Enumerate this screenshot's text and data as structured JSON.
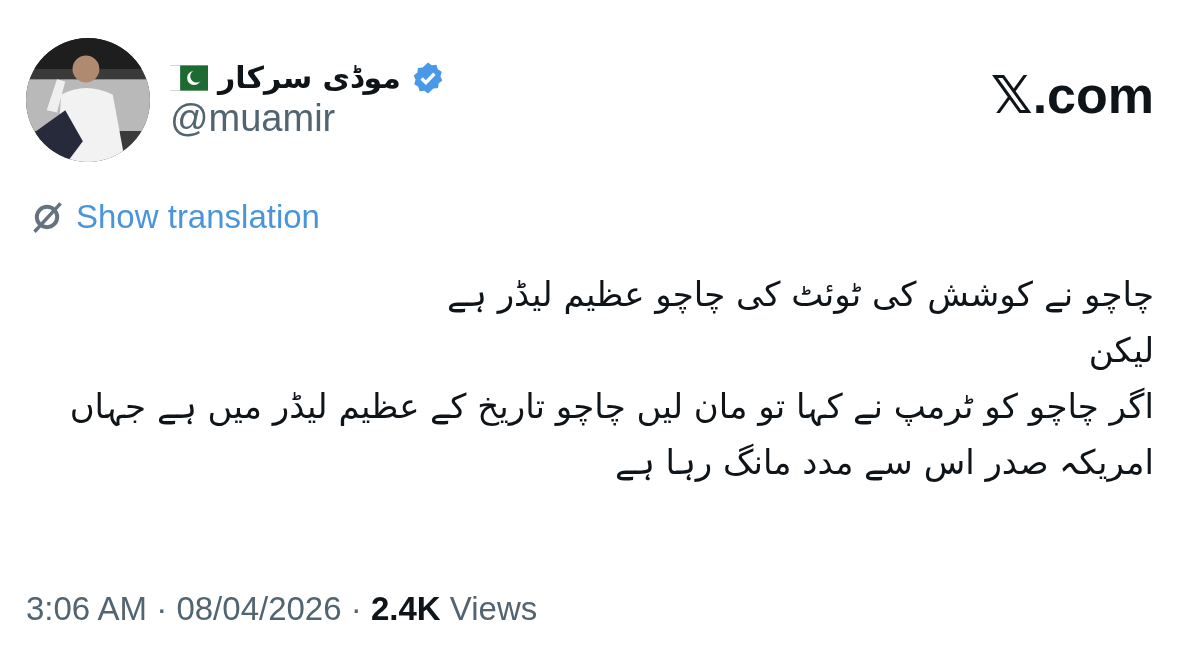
{
  "author": {
    "name": "موڈی سرکار",
    "verified": true,
    "handle": "@muamir"
  },
  "site": {
    "logo_letter": "𝕏",
    "domain": ".com"
  },
  "translate": {
    "label": "Show translation"
  },
  "body": {
    "lines": [
      "چاچو نے کوشش کی ٹوئٹ کی چاچو عظیم لیڈر ہے",
      "لیکن",
      "اگر چاچو کو ٹرمپ نے کہا تو مان لیں چاچو تاریخ کے عظیم لیڈر میں ہے جہاں",
      "امریکہ صدر اس سے مدد مانگ رہا ہے"
    ]
  },
  "meta": {
    "line": "3:06 AM · 08/04/2026 · **2.4K** Views"
  }
}
